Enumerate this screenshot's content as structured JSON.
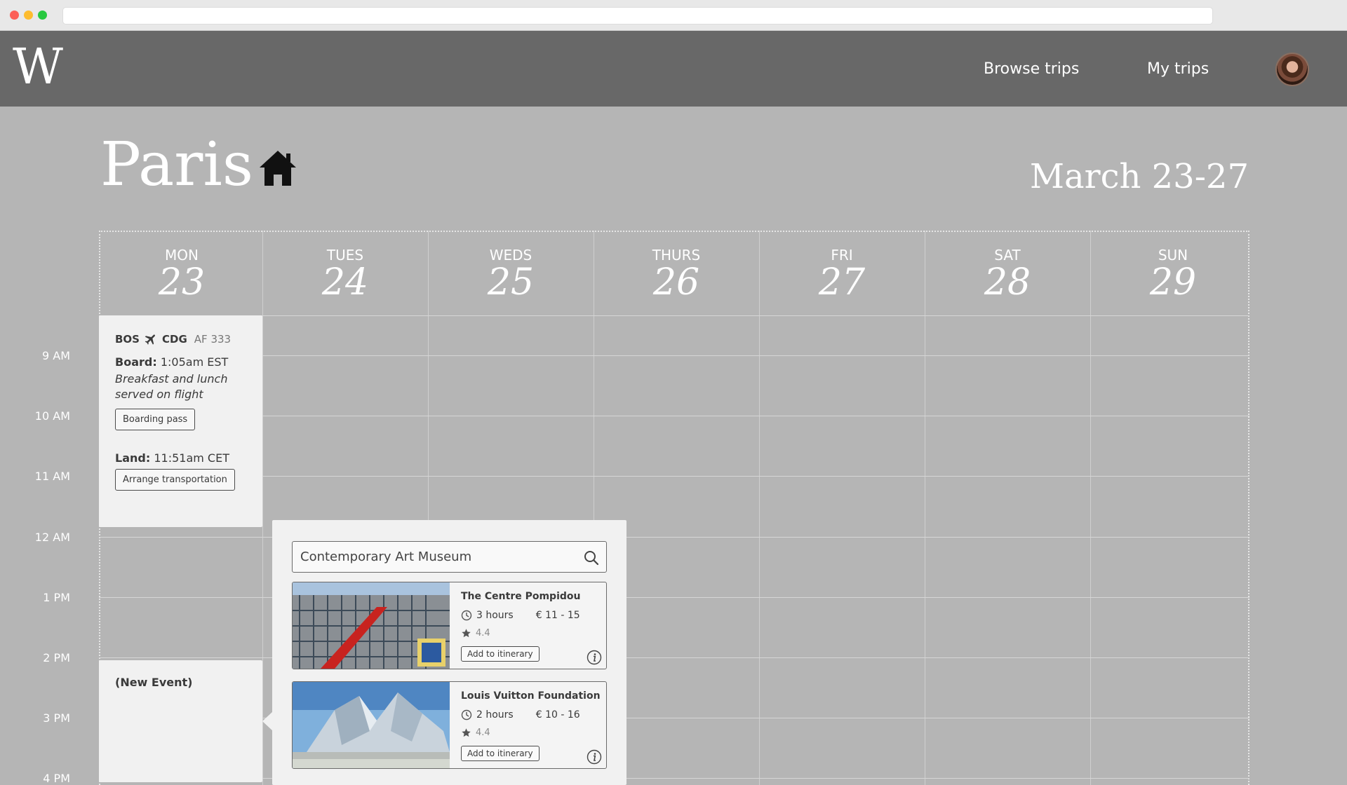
{
  "app": {
    "logo": "W"
  },
  "nav": {
    "browse": "Browse trips",
    "my_trips": "My trips"
  },
  "trip": {
    "city": "Paris",
    "date_range": "March 23-27"
  },
  "days": [
    {
      "name": "MON",
      "num": "23"
    },
    {
      "name": "TUES",
      "num": "24"
    },
    {
      "name": "WEDS",
      "num": "25"
    },
    {
      "name": "THURS",
      "num": "26"
    },
    {
      "name": "FRI",
      "num": "27"
    },
    {
      "name": "SAT",
      "num": "28"
    },
    {
      "name": "SUN",
      "num": "29"
    }
  ],
  "times": [
    "9 AM",
    "10 AM",
    "11 AM",
    "12 AM",
    "1 PM",
    "2 PM",
    "3 PM",
    "4 PM"
  ],
  "flight": {
    "from": "BOS",
    "to": "CDG",
    "number": "AF 333",
    "board_label": "Board:",
    "board_time": "1:05am EST",
    "note": "Breakfast and lunch served on flight",
    "boarding_pass_label": "Boarding pass",
    "land_label": "Land:",
    "land_time": "11:51am CET",
    "transport_label": "Arrange transportation"
  },
  "new_event": {
    "label": "(New Event)"
  },
  "search": {
    "value": "Contemporary Art Museum",
    "results": [
      {
        "title": "The Centre Pompidou",
        "duration": "3 hours",
        "price": "€ 11 - 15",
        "rating": "4.4",
        "add_label": "Add to itinerary"
      },
      {
        "title": "Louis Vuitton Foundation",
        "duration": "2 hours",
        "price": "€ 10 - 16",
        "rating": "4.4",
        "add_label": "Add to itinerary"
      }
    ]
  },
  "colors": {
    "header_bg": "#686868",
    "page_bg": "#b5b5b5",
    "card_bg": "#f1f1f1"
  }
}
